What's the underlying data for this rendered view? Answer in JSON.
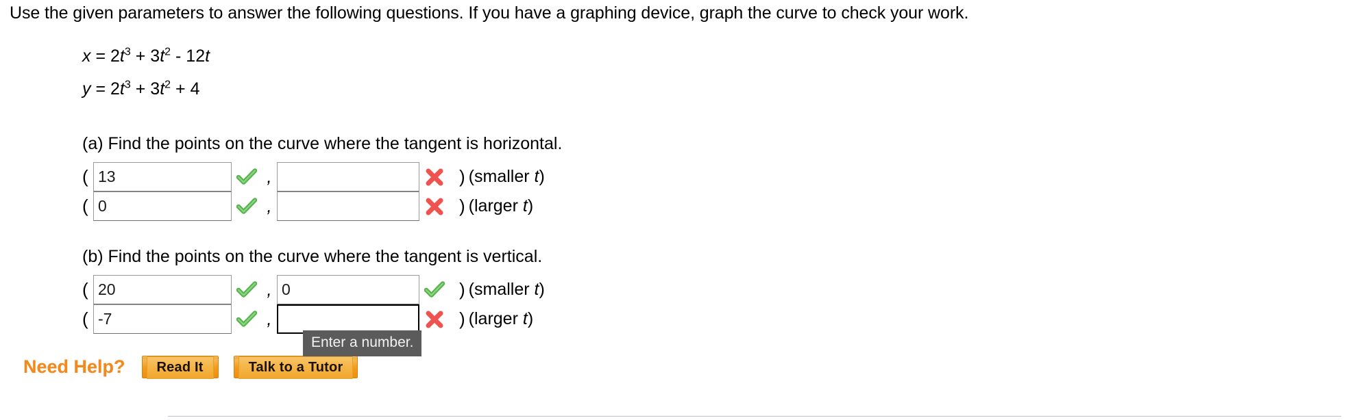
{
  "prompt": "Use the given parameters to answer the following questions. If you have a graphing device, graph the curve to check your work.",
  "equations": [
    {
      "lhs": "x",
      "rhs_parts": [
        "2",
        "t",
        "3",
        " + 3",
        "t",
        "2",
        " - 12",
        "t"
      ],
      "display": "x = 2t^3 + 3t^2 - 12t"
    },
    {
      "lhs": "y",
      "rhs_parts": [
        "2",
        "t",
        "3",
        " + 3",
        "t",
        "2",
        " + 4"
      ],
      "display": "y = 2t^3 + 3t^2 + 4"
    }
  ],
  "eq_x": {
    "var": "x",
    "eq": "=",
    "c1": "2",
    "t1": "t",
    "p1": "3",
    "op1": "+",
    "c2": "3",
    "t2": "t",
    "p2": "2",
    "op2": "-",
    "c3": "12",
    "t3": "t"
  },
  "eq_y": {
    "var": "y",
    "eq": "=",
    "c1": "2",
    "t1": "t",
    "p1": "3",
    "op1": "+",
    "c2": "3",
    "t2": "t",
    "p2": "2",
    "op2": "+",
    "c3": "4"
  },
  "parts": [
    {
      "id": "a",
      "question": "(a) Find the points on the curve where the tangent is horizontal.",
      "rows": [
        {
          "open_paren": "(",
          "x_value": "13",
          "x_status": "correct",
          "comma": ",",
          "y_value": "",
          "y_status": "incorrect",
          "y_focused": false,
          "close_paren": ")",
          "label_prefix": "(smaller ",
          "label_var": "t",
          "label_suffix": ")"
        },
        {
          "open_paren": "(",
          "x_value": "0",
          "x_status": "correct",
          "comma": ",",
          "y_value": "",
          "y_status": "incorrect",
          "y_focused": false,
          "close_paren": ")",
          "label_prefix": "(larger ",
          "label_var": "t",
          "label_suffix": ")"
        }
      ]
    },
    {
      "id": "b",
      "question": "(b) Find the points on the curve where the tangent is vertical.",
      "rows": [
        {
          "open_paren": "(",
          "x_value": "20",
          "x_status": "correct",
          "comma": ",",
          "y_value": "0",
          "y_status": "correct",
          "y_focused": false,
          "close_paren": ")",
          "label_prefix": "(smaller ",
          "label_var": "t",
          "label_suffix": ")"
        },
        {
          "open_paren": "(",
          "x_value": "-7",
          "x_status": "correct",
          "comma": ",",
          "y_value": "",
          "y_status": "incorrect",
          "y_focused": true,
          "close_paren": ")",
          "label_prefix": "(larger ",
          "label_var": "t",
          "label_suffix": ")"
        }
      ]
    }
  ],
  "tooltip": {
    "text": "Enter a number."
  },
  "need_help": {
    "label": "Need Help?",
    "buttons": [
      {
        "label": "Read It"
      },
      {
        "label": "Talk to a Tutor"
      }
    ]
  },
  "colors": {
    "correct": "#54b54a",
    "incorrect": "#ef5350",
    "accent_orange": "#f08a1e",
    "tooltip_bg": "#5b5b5b",
    "divider": "#b9bfcf",
    "field_border": "#9a9a9a"
  },
  "icons": {
    "correct": "check-icon",
    "incorrect": "cross-icon"
  }
}
